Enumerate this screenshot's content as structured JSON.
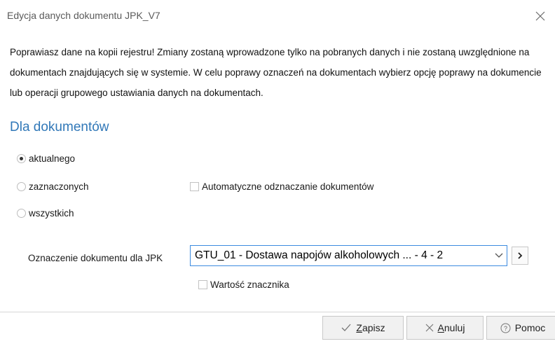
{
  "window": {
    "title": "Edycja danych dokumentu JPK_V7"
  },
  "message": "Poprawiasz dane na kopii rejestru! Zmiany zostaną wprowadzone tylko na pobranych danych i nie zostaną uwzględnione na dokumentach znajdujących się w systemie. W celu poprawy oznaczeń na dokumentach wybierz opcję poprawy na dokumencie lub operacji grupowego ustawiania danych na dokumentach.",
  "section_title": "Dla dokumentów",
  "scope": {
    "options": [
      {
        "label": "aktualnego",
        "selected": true
      },
      {
        "label": "zaznaczonych",
        "selected": false
      },
      {
        "label": "wszystkich",
        "selected": false
      }
    ]
  },
  "auto_unmark": {
    "label": "Automatyczne odznaczanie dokumentów",
    "checked": false
  },
  "jpk_marker": {
    "label": "Oznaczenie dokumentu  dla JPK",
    "value": "GTU_01 - Dostawa napojów alkoholowych ... - 4 - 2"
  },
  "marker_value": {
    "label": "Wartość znacznika",
    "checked": false
  },
  "buttons": {
    "save": {
      "mnemonic": "Z",
      "rest": "apisz"
    },
    "cancel": {
      "mnemonic": "A",
      "rest": "nuluj"
    },
    "help": {
      "label": "Pomoc"
    }
  },
  "colors": {
    "accent": "#3178b8",
    "focus_border": "#3c8be0"
  }
}
